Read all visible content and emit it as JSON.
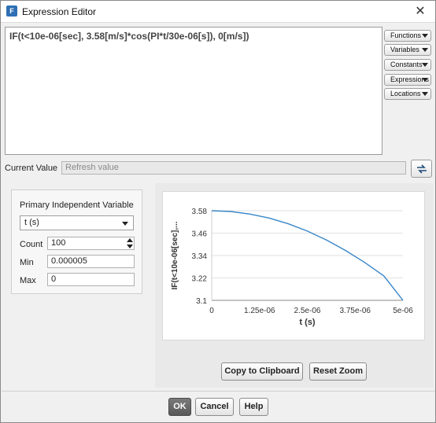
{
  "window": {
    "title": "Expression Editor",
    "close_symbol": "✕"
  },
  "expression": "IF(t<10e-06[sec], 3.58[m/s]*cos(PI*t/30e-06[s]), 0[m/s])",
  "menus": {
    "functions": "Functions",
    "variables": "Variables",
    "constants": "Constants",
    "expressions": "Expressions",
    "locations": "Locations"
  },
  "current_value": {
    "label": "Current Value",
    "placeholder": "Refresh value"
  },
  "piv": {
    "title": "Primary Independent Variable",
    "selected": "t (s)",
    "count_label": "Count",
    "count_value": "100",
    "min_label": "Min",
    "min_value": "0.000005",
    "max_label": "Max",
    "max_value": "0"
  },
  "chart_data": {
    "type": "line",
    "xlabel": "t (s)",
    "ylabel": "IF(t<10e-06[sec],...",
    "x_ticks": [
      "0",
      "1.25e-06",
      "2.5e-06",
      "3.75e-06",
      "5e-06"
    ],
    "y_ticks": [
      "3.58",
      "3.46",
      "3.34",
      "3.22",
      "3.1"
    ],
    "xlim": [
      0,
      5e-06
    ],
    "ylim": [
      3.1,
      3.58
    ],
    "series": [
      {
        "x": [
          0,
          5e-07,
          1e-06,
          1.5e-06,
          2e-06,
          2.5e-06,
          3e-06,
          3.5e-06,
          4e-06,
          4.5e-06,
          5e-06
        ],
        "values": [
          3.58,
          3.576,
          3.562,
          3.541,
          3.51,
          3.471,
          3.423,
          3.367,
          3.303,
          3.231,
          3.1
        ]
      }
    ],
    "line_color": "#3a86c8"
  },
  "actions": {
    "copy": "Copy to Clipboard",
    "reset_zoom": "Reset Zoom"
  },
  "footer": {
    "ok": "OK",
    "cancel": "Cancel",
    "help": "Help"
  }
}
